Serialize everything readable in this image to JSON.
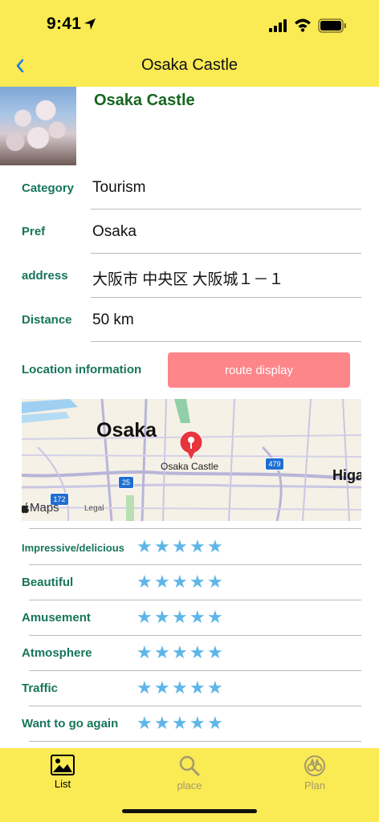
{
  "status_bar": {
    "time": "9:41"
  },
  "nav": {
    "title": "Osaka Castle",
    "back_icon": "chevron-left-icon"
  },
  "place": {
    "name": "Osaka Castle"
  },
  "info": [
    {
      "label": "Category",
      "value": "Tourism"
    },
    {
      "label": "Pref",
      "value": "Osaka"
    },
    {
      "label": "address",
      "value": "大阪市 中央区 大阪城１－１"
    },
    {
      "label": "Distance",
      "value": "50 km"
    }
  ],
  "location": {
    "label": "Location information",
    "route_button": "route display"
  },
  "map": {
    "city": "Osaka",
    "pin_label": "Osaka Castle",
    "edge_label": "Higa",
    "attribution": "Maps",
    "legal": "Legal",
    "route_shields": [
      "479",
      "25",
      "172"
    ]
  },
  "ratings": [
    {
      "label": "Impressive/delicious",
      "stars": 5
    },
    {
      "label": "Beautiful",
      "stars": 5
    },
    {
      "label": "Amusement",
      "stars": 5
    },
    {
      "label": "Atmosphere",
      "stars": 5
    },
    {
      "label": "Traffic",
      "stars": 5
    },
    {
      "label": "Want to go again",
      "stars": 5
    }
  ],
  "tabs": [
    {
      "label": "List",
      "icon": "photo-icon",
      "active": true
    },
    {
      "label": "place",
      "icon": "search-icon",
      "active": false
    },
    {
      "label": "Plan",
      "icon": "binoculars-icon",
      "active": false
    }
  ],
  "colors": {
    "header_bg": "#faea53",
    "label_green": "#17755a",
    "title_green": "#17661f",
    "route_button": "#fd868b",
    "star": "#5eb6e8"
  }
}
